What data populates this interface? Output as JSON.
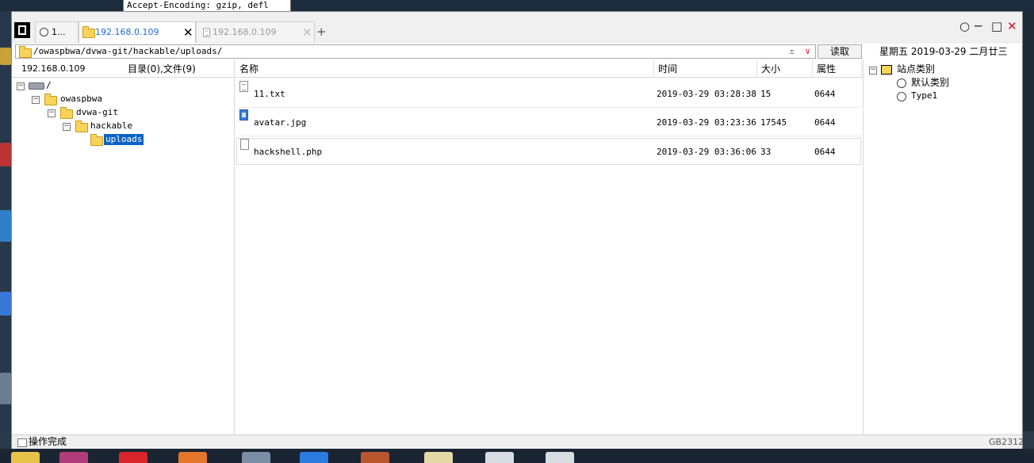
{
  "background_text": "Accept-Encoding: gzip, defl",
  "tabs": [
    {
      "label": "1...",
      "active": false
    },
    {
      "label": "192.168.0.109",
      "active": true
    },
    {
      "label": "192.168.0.109",
      "active": false
    }
  ],
  "tab_close_glyph": "✕",
  "add_tab_glyph": "+",
  "window_controls": {
    "circle": "○",
    "minimize": "─",
    "maximize": "□",
    "close": "✕"
  },
  "path": {
    "value": "/owaspbwa/dvwa-git/hackable/uploads/",
    "read_button": "读取"
  },
  "date_display": "星期五 2019-03-29 二月廿三",
  "left_header": {
    "host": "192.168.0.109",
    "summary": "目录(0),文件(9)"
  },
  "tree": [
    {
      "label": "/"
    },
    {
      "label": "owaspbwa"
    },
    {
      "label": "dvwa-git"
    },
    {
      "label": "hackable"
    },
    {
      "label": "uploads",
      "selected": true
    }
  ],
  "columns": {
    "name": "名称",
    "time": "时间",
    "size": "大小",
    "attr": "属性"
  },
  "files": [
    {
      "name": "11.txt",
      "time": "2019-03-29 03:28:38",
      "size": "15",
      "attr": "0644"
    },
    {
      "name": "avatar.jpg",
      "time": "2019-03-29 03:23:36",
      "size": "17545",
      "attr": "0644"
    },
    {
      "name": "hackshell.php",
      "time": "2019-03-29 03:36:06",
      "size": "33",
      "attr": "0644"
    }
  ],
  "site_tree": {
    "root": "站点类别",
    "children": [
      {
        "label": "默认类别"
      },
      {
        "label": "Type1"
      }
    ]
  },
  "status": {
    "left": "操作完成",
    "encoding": "GB2312"
  },
  "colors": {
    "accent": "#1a6fd6",
    "selection": "#0a63c6",
    "close_red": "#d11a2a",
    "folder": "#f7d35a"
  }
}
